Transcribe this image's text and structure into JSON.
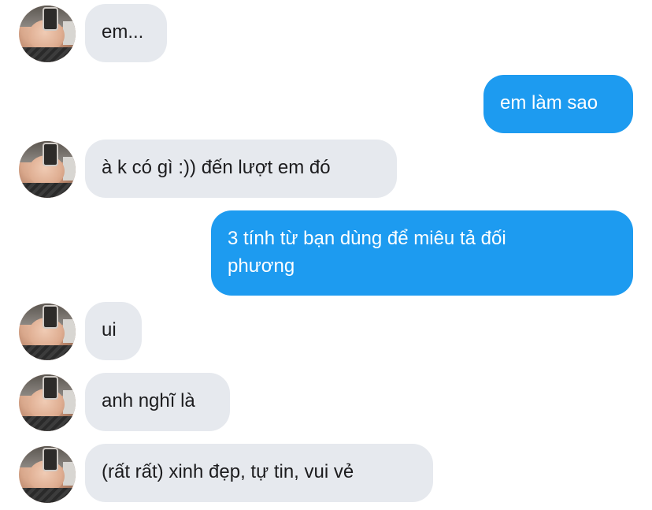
{
  "conversation": {
    "messages": [
      {
        "sender": "other",
        "text": "em..."
      },
      {
        "sender": "me",
        "text": "em làm sao"
      },
      {
        "sender": "other",
        "text": "à k có gì :)) đến lượt em đó"
      },
      {
        "sender": "me",
        "line1": "3 tính từ bạn dùng để miêu tả đối",
        "line2": "phương"
      },
      {
        "sender": "other",
        "text": "ui"
      },
      {
        "sender": "other",
        "text": "anh nghĩ là"
      },
      {
        "sender": "other",
        "text": "(rất rất) xinh đẹp, tự tin, vui vẻ"
      }
    ]
  },
  "colors": {
    "incoming_bubble": "#e6e9ee",
    "outgoing_bubble": "#1d9bf0",
    "incoming_text": "#1c1c1e",
    "outgoing_text": "#ffffff"
  },
  "icons": {
    "avatar": "user-avatar-photo"
  }
}
